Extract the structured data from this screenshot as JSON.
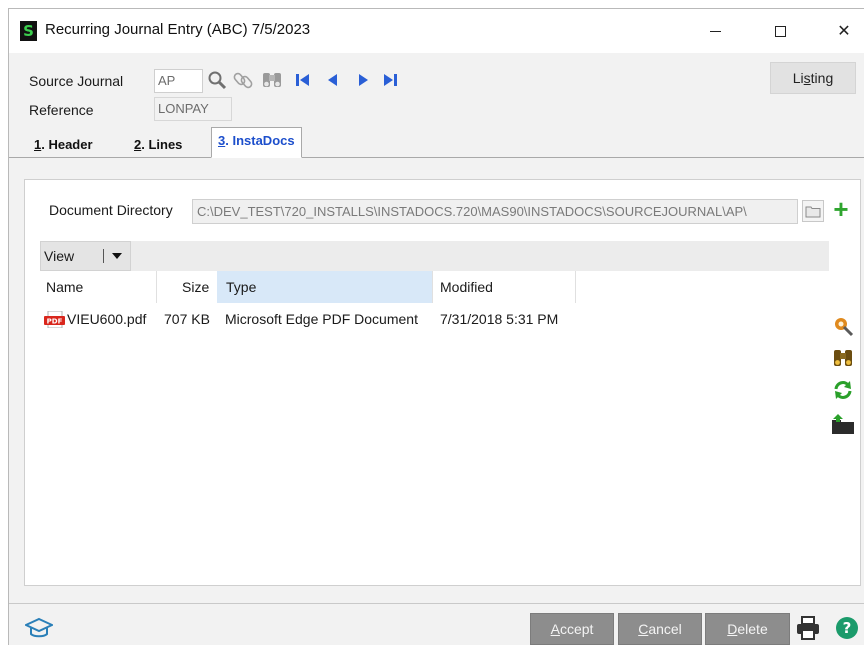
{
  "window": {
    "title": "Recurring Journal Entry (ABC) 7/5/2023",
    "app_icon_letter": "S",
    "controls": {
      "minimize": "minimize",
      "maximize": "maximize",
      "close": "✕"
    }
  },
  "header": {
    "source_journal_label": "Source Journal",
    "source_journal_value": "AP",
    "reference_label": "Reference",
    "reference_value": "LONPAY",
    "listing_button": {
      "pre": "Li",
      "mnemonic": "s",
      "post": "ting"
    },
    "toolbar_icons": [
      "lookup-icon",
      "link-icon",
      "binoculars-icon",
      "first-record-icon",
      "previous-record-icon",
      "next-record-icon",
      "last-record-icon"
    ]
  },
  "tabs": [
    {
      "num": "1",
      "label": ". Header",
      "active": false
    },
    {
      "num": "2",
      "label": ". Lines",
      "active": false
    },
    {
      "num": "3",
      "label": ". InstaDocs",
      "active": true
    }
  ],
  "instadocs": {
    "directory_label": "Document Directory",
    "directory_value": "C:\\DEV_TEST\\720_INSTALLS\\INSTADOCS.720\\MAS90\\INSTADOCS\\SOURCEJOURNAL\\AP\\",
    "view_label": "View",
    "columns": [
      "Name",
      "Size",
      "Type",
      "Modified"
    ],
    "files": [
      {
        "name": "VIEU600.pdf",
        "size": "707 KB",
        "type": "Microsoft Edge PDF Document",
        "modified": "7/31/2018 5:31 PM",
        "icon": "pdf-file-icon"
      }
    ],
    "side_icons": [
      "settings-wand-icon",
      "search-binoculars-icon",
      "refresh-icon",
      "upload-folder-icon"
    ]
  },
  "footer": {
    "accept": {
      "mnemonic": "A",
      "rest": "ccept"
    },
    "cancel": {
      "mnemonic": "C",
      "rest": "ancel"
    },
    "delete": {
      "mnemonic": "D",
      "rest": "elete"
    }
  },
  "colors": {
    "accent_blue": "#1d4fcc",
    "nav_blue": "#2a5fd6",
    "add_green": "#2fa52f",
    "footer_button": "#8d8d8d",
    "selected_column": "#d8e8f8",
    "help_green": "#1b9b6b"
  }
}
